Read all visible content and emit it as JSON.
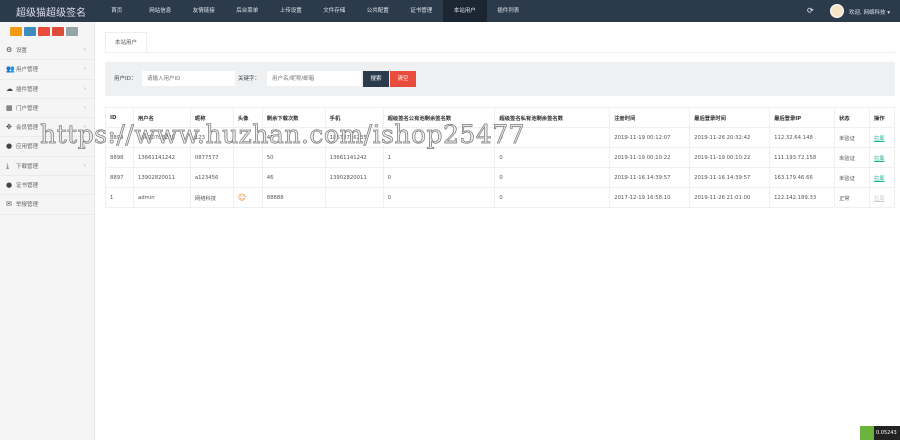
{
  "header": {
    "logo": "超级猫超级签名",
    "nav": [
      "首页",
      "网站信息",
      "友情链接",
      "后台菜单",
      "上传设置",
      "文件存储",
      "公共配置",
      "证书管理",
      "本站用户",
      "插件列表"
    ],
    "active_nav": 8,
    "user": "欢迎, 网络科技 ▾"
  },
  "sidebar": {
    "quick_colors": [
      "#f39c12",
      "#3c8dbc",
      "#e74c3c",
      "#dd4b39",
      "#95a5a6"
    ],
    "items": [
      {
        "label": "设置",
        "icon": "⚙",
        "chev": true
      },
      {
        "label": "用户管理",
        "icon": "👥",
        "chev": true
      },
      {
        "label": "插件管理",
        "icon": "☁",
        "chev": true
      },
      {
        "label": "门户管理",
        "icon": "▦",
        "chev": true
      },
      {
        "label": "会员管理",
        "icon": "✥",
        "chev": true
      },
      {
        "label": "应用管理",
        "icon": "●",
        "chev": true
      },
      {
        "label": "下载管理",
        "icon": "⤓",
        "chev": true
      },
      {
        "label": "证书管理",
        "icon": "●",
        "chev": false
      },
      {
        "label": "举报管理",
        "icon": "✉",
        "chev": false
      }
    ]
  },
  "tab": "本站用户",
  "search": {
    "id_label": "用户ID：",
    "id_placeholder": "请输入用户ID",
    "kw_label": "关键字：",
    "kw_placeholder": "用户名/昵称/邮箱",
    "search_btn": "搜索",
    "clear_btn": "清空"
  },
  "table": {
    "headers": [
      "ID",
      "用户名",
      "昵称",
      "头像",
      "剩余下载次数",
      "手机",
      "超级签名公有池剩余签名数",
      "超级签名私有池剩余签名数",
      "注册时间",
      "最后登录时间",
      "最后登录IP",
      "状态",
      "操作"
    ],
    "rows": [
      [
        "8899",
        "18670706235",
        "123",
        "",
        "45",
        "18670706235",
        "",
        "0",
        "2019-11-19 00:12:07",
        "2019-11-26 20:32:42",
        "112.32.64.148",
        "未验证",
        "拉黑"
      ],
      [
        "8898",
        "13661141242",
        "0877577",
        "",
        "50",
        "13661141242",
        "1",
        "0",
        "2019-11-19 00:10:22",
        "2019-11-19 00:10:22",
        "111.193.72.158",
        "未验证",
        "拉黑"
      ],
      [
        "8897",
        "13902820011",
        "a123456",
        "",
        "46",
        "13902820011",
        "0",
        "0",
        "2019-11-16 14:39:57",
        "2019-11-16 14:39:57",
        "163.179.46.66",
        "未验证",
        "拉黑"
      ],
      [
        "1",
        "admin",
        "网络科技",
        "avatar",
        "88888",
        "",
        "0",
        "0",
        "2017-12-19 16:58:10",
        "2019-11-26 21:01:00",
        "122.142.189.33",
        "正常",
        "拉黑"
      ]
    ]
  },
  "watermark": "https://www.huzhan.com/ishop25477",
  "badge": "0.05243"
}
